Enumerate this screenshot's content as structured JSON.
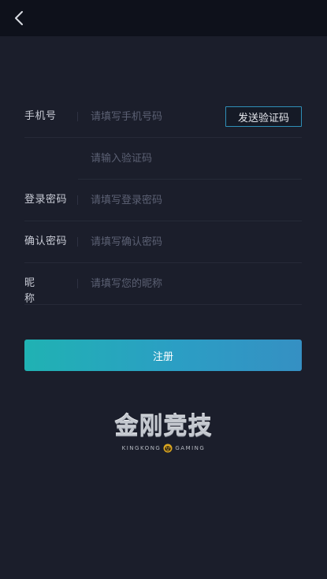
{
  "form": {
    "phone": {
      "label": "手机号",
      "placeholder": "请填写手机号码"
    },
    "send_code_label": "发送验证码",
    "code": {
      "placeholder": "请输入验证码"
    },
    "password": {
      "label": "登录密码",
      "placeholder": "请填写登录密码"
    },
    "confirm": {
      "label": "确认密码",
      "placeholder": "请填写确认密码"
    },
    "nickname": {
      "label": "昵称",
      "placeholder": "请填写您的昵称"
    }
  },
  "register_label": "注册",
  "logo": {
    "title": "金刚竞技",
    "sub_left": "KINGKONG",
    "sub_right": "GAMING"
  },
  "icons": {
    "back": "chevron-left-icon",
    "logo_mark": "gorilla-icon"
  },
  "colors": {
    "background": "#1b1e2b",
    "topbar": "#0e111b",
    "accent": "#2b9ec4",
    "send_button_border": "#2f8fb7"
  }
}
